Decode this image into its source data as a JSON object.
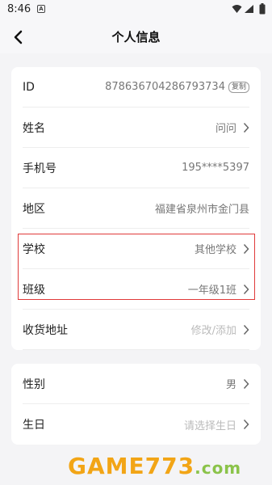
{
  "status": {
    "time": "8:46",
    "indicator": "A"
  },
  "header": {
    "title": "个人信息"
  },
  "profile_rows": [
    {
      "label": "ID",
      "value": "878636704286793734",
      "badge": "复制"
    },
    {
      "label": "姓名",
      "value": "问问"
    },
    {
      "label": "手机号",
      "value": "195****5397"
    },
    {
      "label": "地区",
      "value": "福建省泉州市金门县"
    },
    {
      "label": "学校",
      "value": "其他学校"
    },
    {
      "label": "班级",
      "value": "一年级1班"
    },
    {
      "label": "收货地址",
      "value": "修改/添加"
    }
  ],
  "extra_rows": [
    {
      "label": "性别",
      "value": "男"
    },
    {
      "label": "生日",
      "value": "请选择生日"
    }
  ],
  "watermark": {
    "part1": "GAME",
    "part2": "773",
    "part3": ".com"
  },
  "colors": {
    "highlight": "#e03a3a",
    "watermark_orange": "#f2a516",
    "watermark_green": "#8bc34a"
  }
}
